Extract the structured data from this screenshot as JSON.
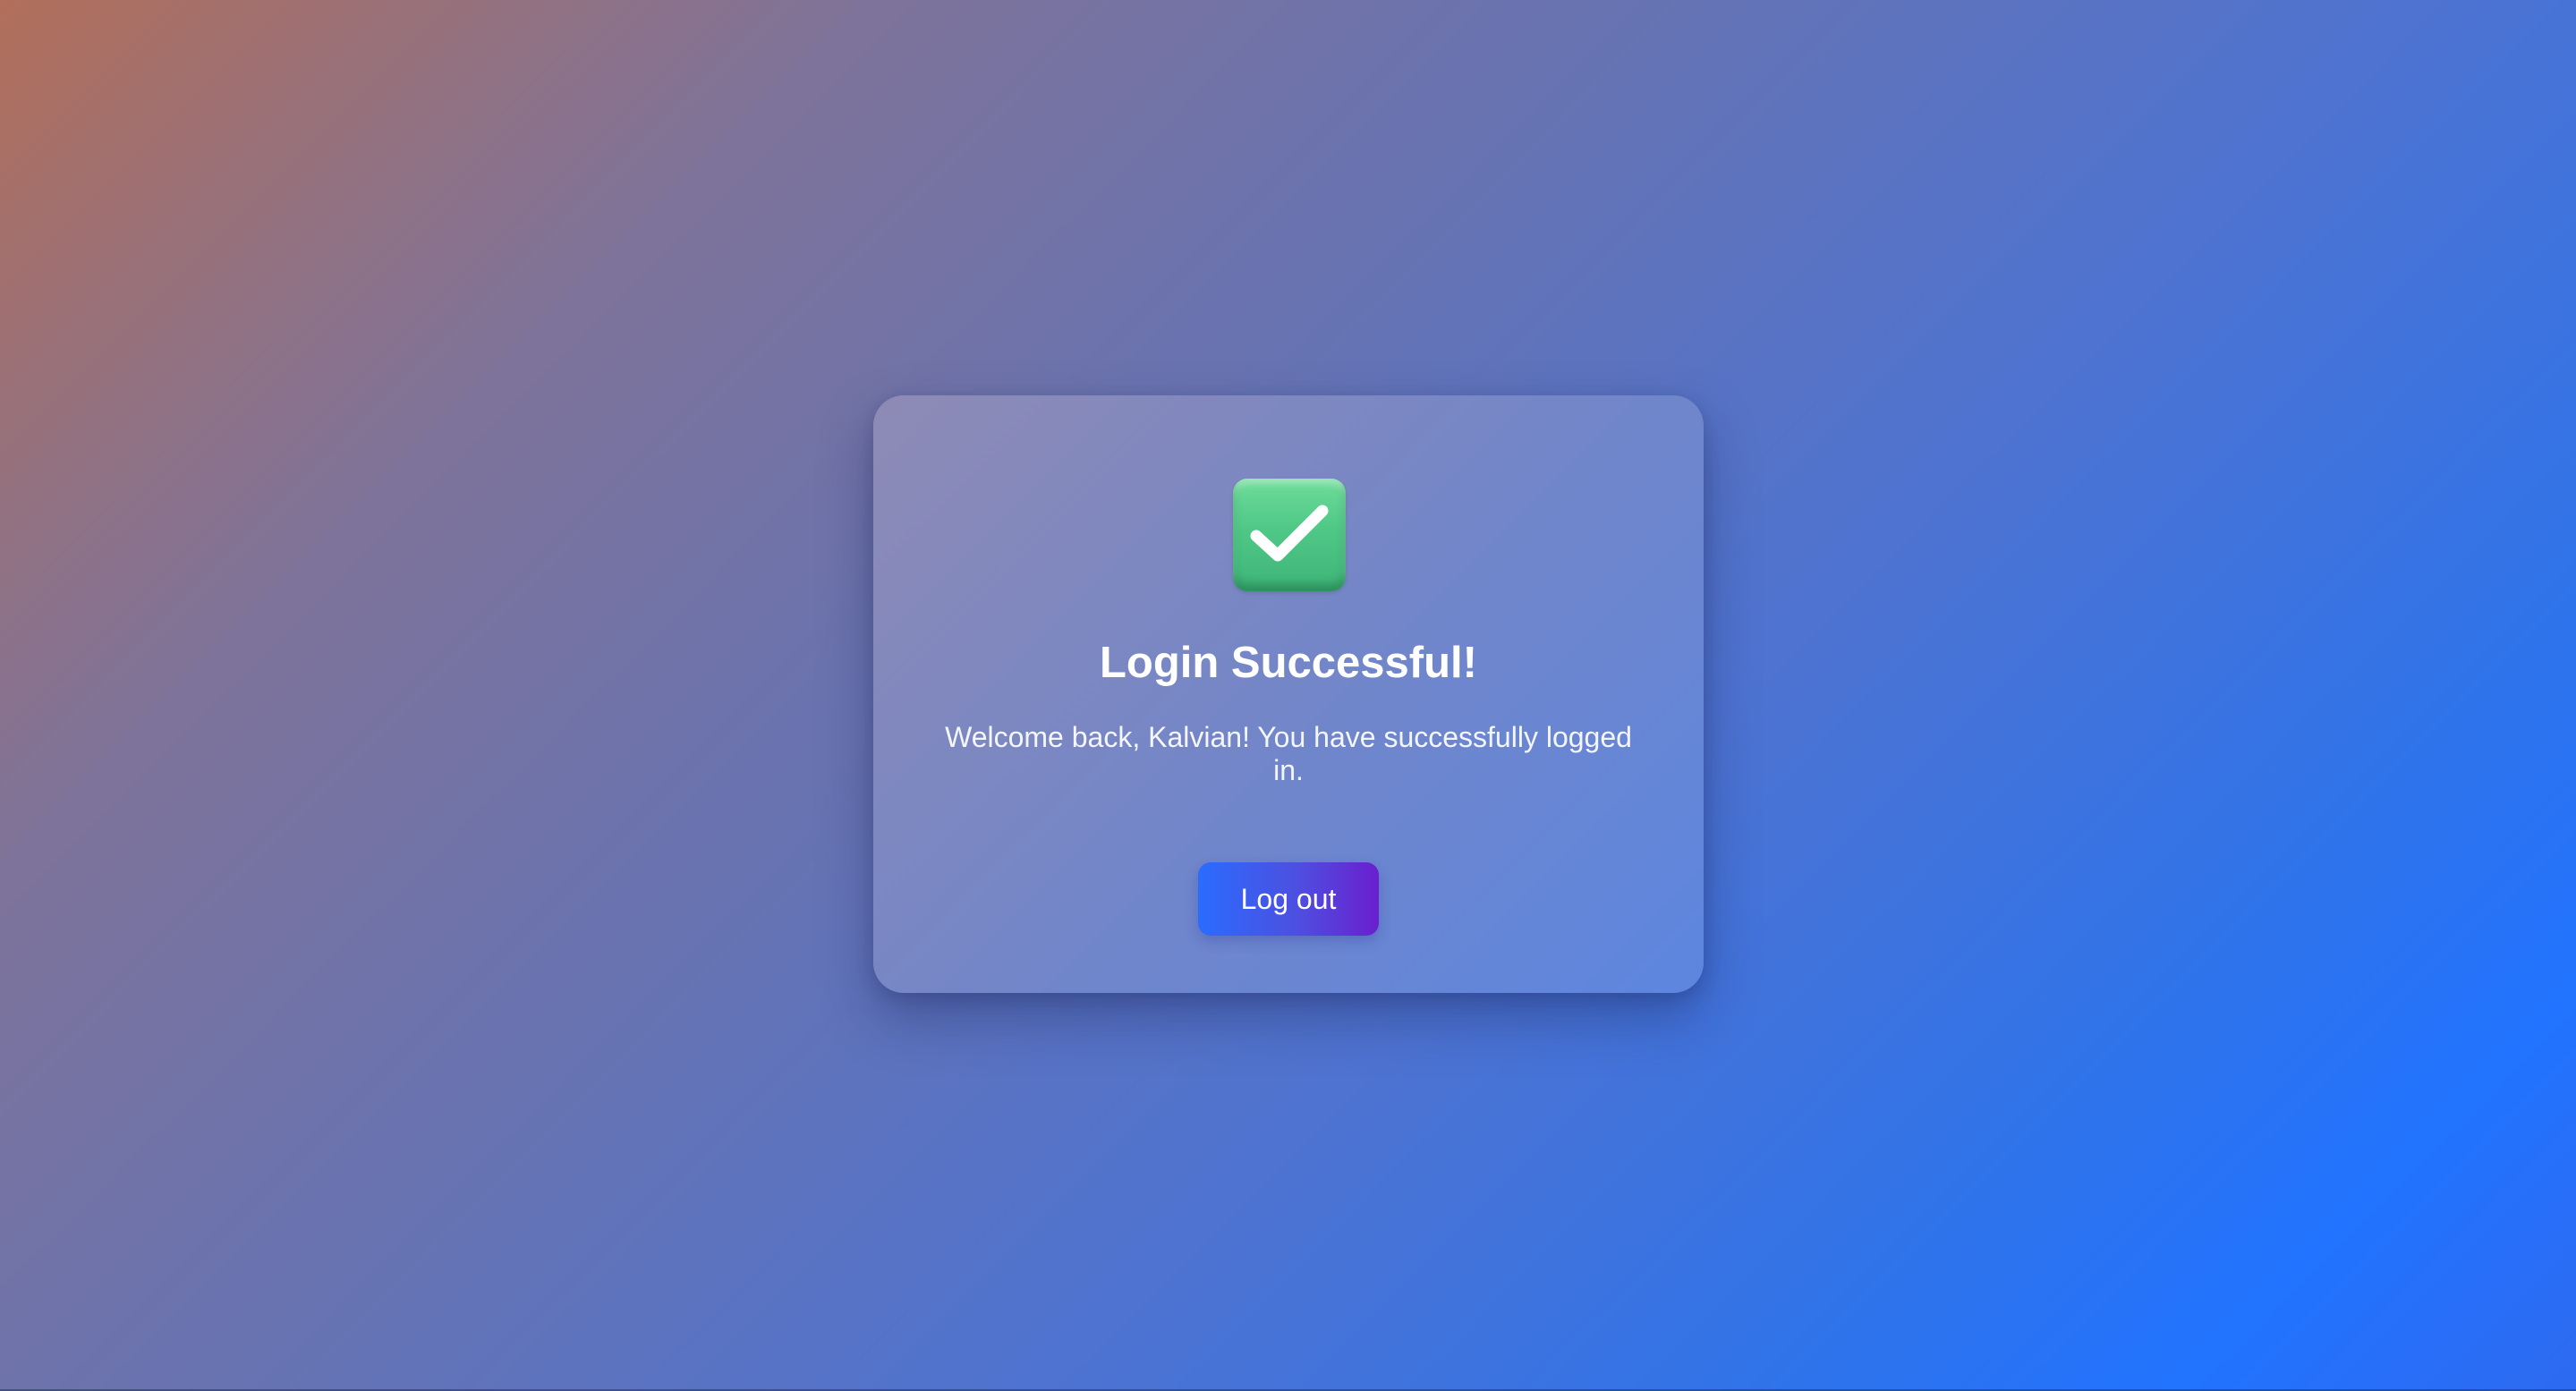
{
  "card": {
    "icon": "check-mark-icon",
    "title": "Login Successful!",
    "message": "Welcome back, Kalvian! You have successfully logged in.",
    "logout_label": "Log out"
  },
  "colors": {
    "icon_green": "#4fc887",
    "button_start": "#2a6cff",
    "button_end": "#6a1fcf"
  }
}
